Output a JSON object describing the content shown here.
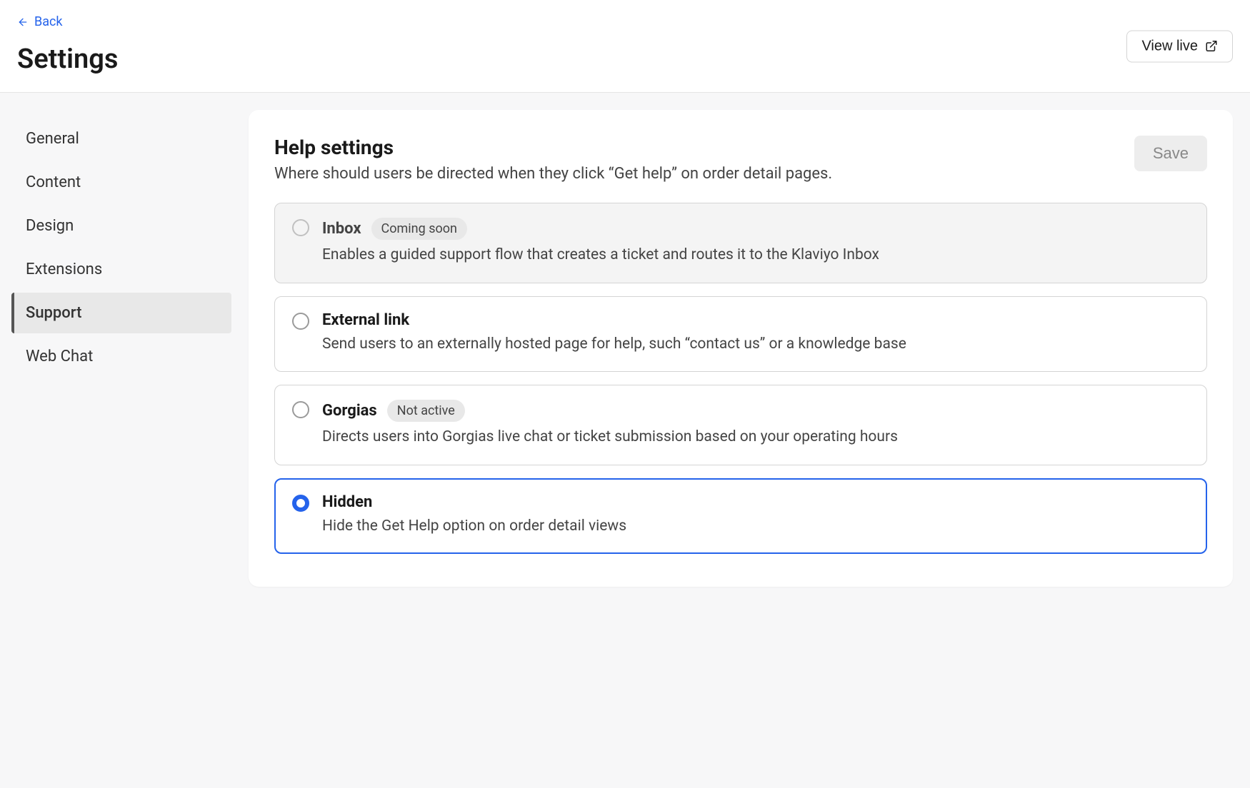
{
  "header": {
    "back_label": "Back",
    "page_title": "Settings",
    "view_live_label": "View live"
  },
  "sidebar": {
    "items": [
      {
        "label": "General",
        "active": false
      },
      {
        "label": "Content",
        "active": false
      },
      {
        "label": "Design",
        "active": false
      },
      {
        "label": "Extensions",
        "active": false
      },
      {
        "label": "Support",
        "active": true
      },
      {
        "label": "Web Chat",
        "active": false
      }
    ]
  },
  "panel": {
    "title": "Help settings",
    "description": "Where should users be directed when they click “Get help” on order detail pages.",
    "save_label": "Save",
    "save_disabled": true,
    "options": [
      {
        "id": "inbox",
        "title": "Inbox",
        "badge": "Coming soon",
        "description": "Enables a guided support flow that creates a ticket and routes it to the Klaviyo Inbox",
        "disabled": true,
        "selected": false
      },
      {
        "id": "external",
        "title": "External link",
        "badge": null,
        "description": "Send users to an externally hosted page for help, such “contact us” or a knowledge base",
        "disabled": false,
        "selected": false
      },
      {
        "id": "gorgias",
        "title": "Gorgias",
        "badge": "Not active",
        "description": "Directs users into Gorgias live chat or ticket submission based on your operating hours",
        "disabled": false,
        "selected": false
      },
      {
        "id": "hidden",
        "title": "Hidden",
        "badge": null,
        "description": "Hide the Get Help option on order detail views",
        "disabled": false,
        "selected": true
      }
    ]
  }
}
